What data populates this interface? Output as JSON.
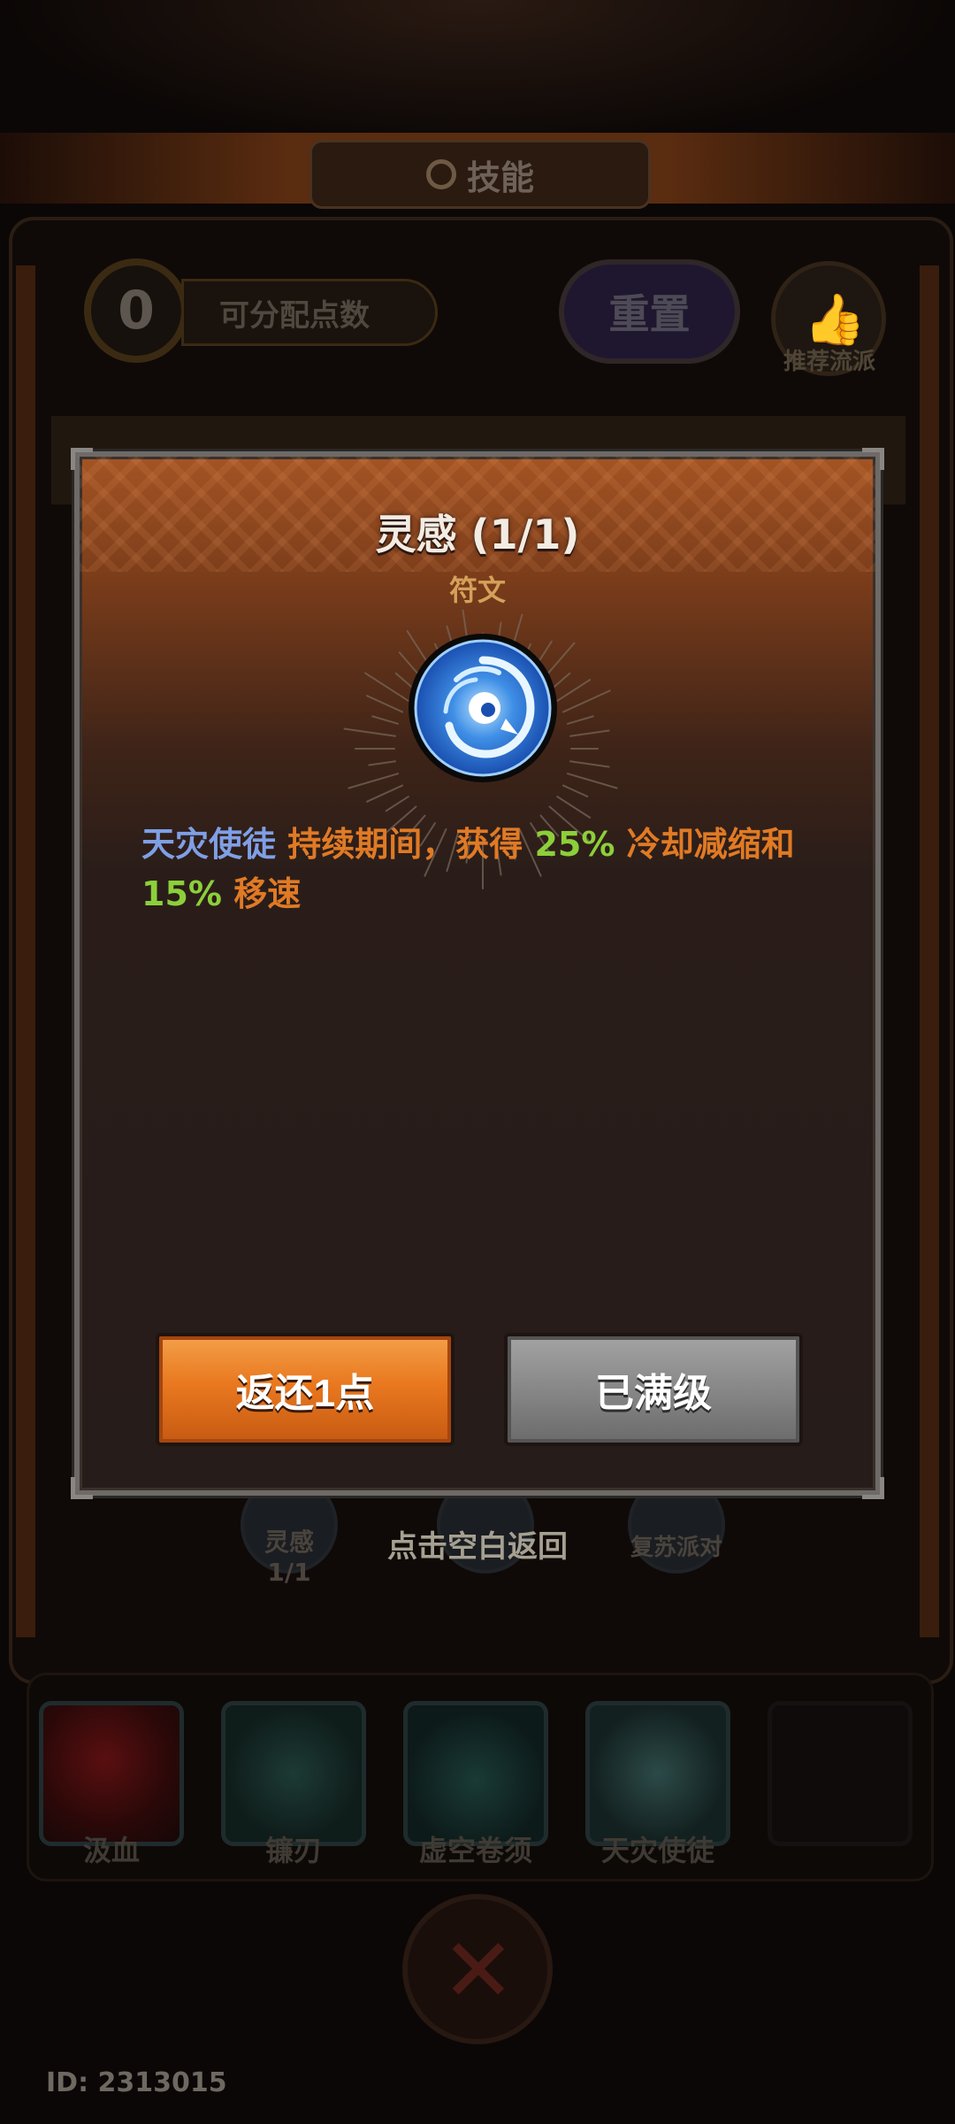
{
  "header": {
    "title": "技能"
  },
  "top_bar": {
    "points_value": "0",
    "points_label": "可分配点数",
    "reset_label": "重置",
    "recommend_label": "推荐流派"
  },
  "modal": {
    "title": "灵感 (1/1)",
    "subtitle": "符文",
    "description": {
      "part1": "天灾使徒",
      "part2": " 持续期间，获得 ",
      "part3": "25%",
      "part4": " 冷却减缩和 ",
      "part5": "15%",
      "part6": " 移速"
    },
    "return_button": "返还1点",
    "max_button": "已满级"
  },
  "background_skills": [
    {
      "label": "灵感",
      "level": "1/1"
    },
    {
      "label": "复苏派对"
    }
  ],
  "tap_back_hint": "点击空白返回",
  "runes": [
    {
      "label": "汲血"
    },
    {
      "label": "镰刃"
    },
    {
      "label": "虚空卷须"
    },
    {
      "label": "天灾使徒"
    }
  ],
  "player_id": "ID: 2313015",
  "colors": {
    "accent_blue": "#7f9fe6",
    "accent_orange": "#e07a25",
    "accent_green": "#8ccf3a",
    "return_button": "#e9781f",
    "max_button": "#8a8a8a"
  },
  "icons": {
    "title": "emblem-icon",
    "recommend": "thumbs-up-icon",
    "rune": "vortex-rune-icon",
    "center": "crossed-blades-icon"
  }
}
